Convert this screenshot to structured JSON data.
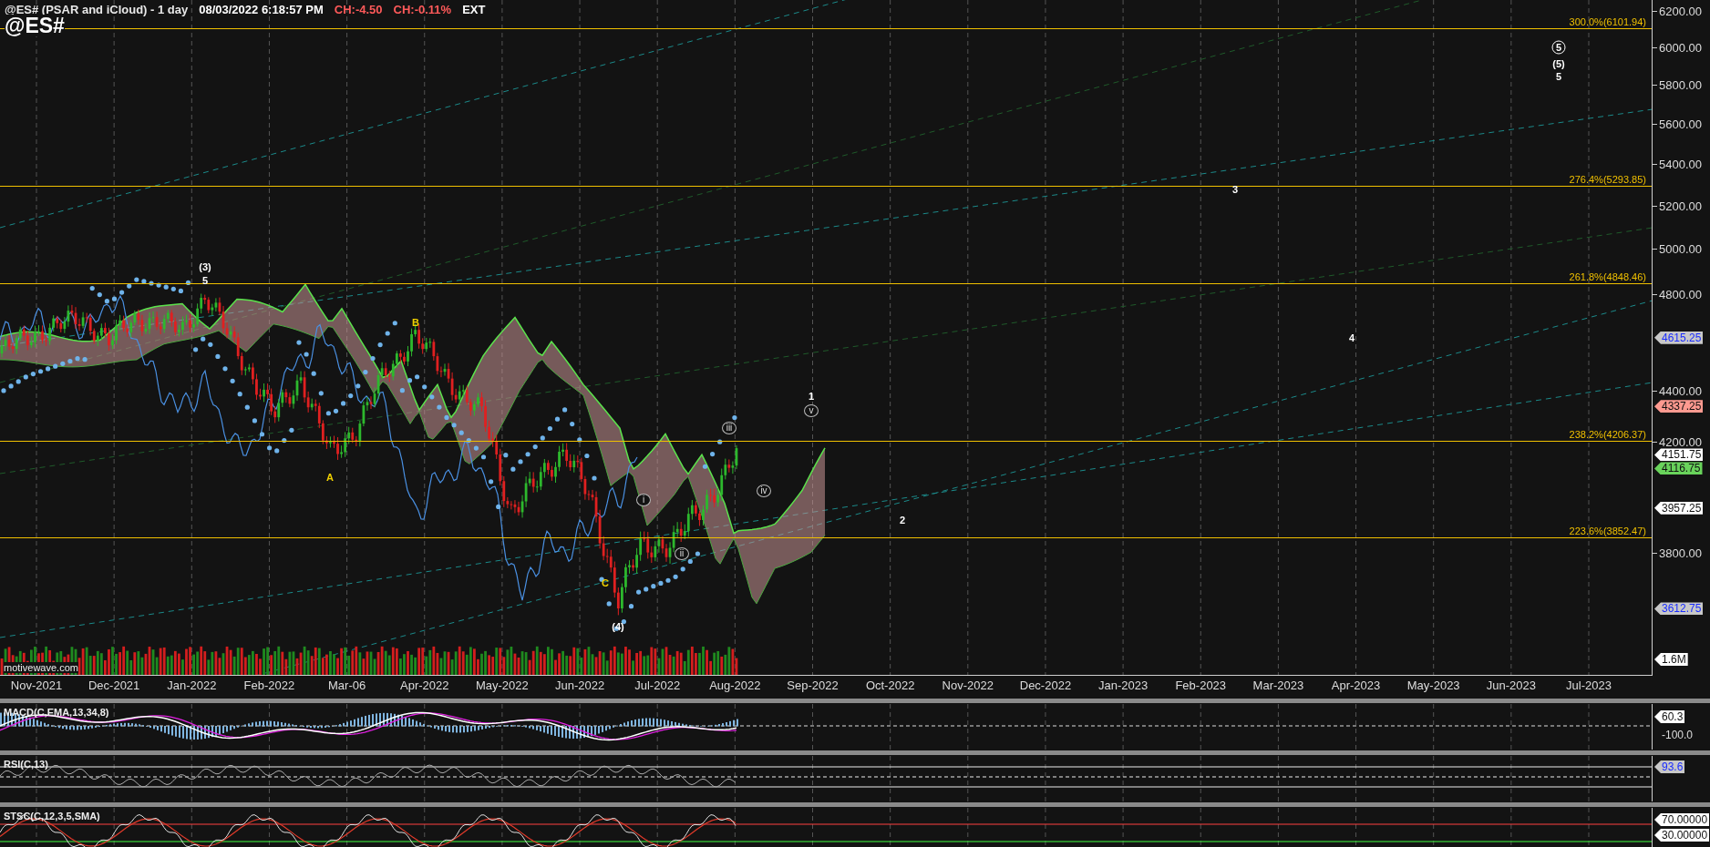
{
  "header": {
    "title": "@ES# (PSAR and iCloud) - 1 day",
    "timestamp": "08/03/2022 6:18:57 PM",
    "changes": [
      "CH:-4.50",
      "CH:-0.11%"
    ],
    "session": "EXT",
    "symbol": "@ES#"
  },
  "source": "motivewave.com",
  "price_axis": {
    "ticks": [
      "6200.00",
      "6000.00",
      "5800.00",
      "5600.00",
      "5400.00",
      "5200.00",
      "5000.00",
      "4800.00",
      "4400.00",
      "4200.00",
      "3800.00"
    ],
    "tags": [
      {
        "text": "4615.25",
        "kind": "blue"
      },
      {
        "text": "4337.25",
        "kind": "red"
      },
      {
        "text": "4151.75",
        "kind": "white"
      },
      {
        "text": "4116.75",
        "kind": "green"
      },
      {
        "text": "3957.25",
        "kind": "white"
      },
      {
        "text": "3612.75",
        "kind": "blue"
      }
    ],
    "volume_tag": "1.6M"
  },
  "fib_levels": [
    "300.0%(6101.94)",
    "276.4%(5293.85)",
    "261.8%(4848.46)",
    "238.2%(4206.37)",
    "223.6%(3852.47)"
  ],
  "wave_labels": [
    {
      "text": "(3)",
      "kind": "plain"
    },
    {
      "text": "5",
      "kind": "plain"
    },
    {
      "text": "B",
      "kind": "letter"
    },
    {
      "text": "A",
      "kind": "letter"
    },
    {
      "text": "C",
      "kind": "letter"
    },
    {
      "text": "(4)",
      "kind": "plain"
    },
    {
      "text": "i",
      "kind": "roman"
    },
    {
      "text": "ii",
      "kind": "roman"
    },
    {
      "text": "iii",
      "kind": "roman"
    },
    {
      "text": "iv",
      "kind": "roman"
    },
    {
      "text": "1",
      "kind": "plain"
    },
    {
      "text": "v",
      "kind": "roman"
    },
    {
      "text": "2",
      "kind": "plain"
    },
    {
      "text": "3",
      "kind": "plain"
    },
    {
      "text": "4",
      "kind": "plain"
    },
    {
      "text": "5",
      "kind": "circled"
    },
    {
      "text": "(5)",
      "kind": "plain"
    },
    {
      "text": "5",
      "kind": "plain"
    }
  ],
  "date_axis": [
    "Nov-2021",
    "Dec-2021",
    "Jan-2022",
    "Feb-2022",
    "Mar-06",
    "Apr-2022",
    "May-2022",
    "Jun-2022",
    "Jul-2022",
    "Aug-2022",
    "Sep-2022",
    "Oct-2022",
    "Nov-2022",
    "Dec-2022",
    "Jan-2023",
    "Feb-2023",
    "Mar-2023",
    "Apr-2023",
    "May-2023",
    "Jun-2023",
    "Jul-2023"
  ],
  "indicators": [
    {
      "kind": "macd",
      "label": "MACD(C,EMA,13,34,8)",
      "tags": [
        {
          "text": "60.3",
          "kind": "white"
        },
        {
          "text": "-100.0",
          "kind": "plain"
        }
      ]
    },
    {
      "kind": "rsi",
      "label": "RSI(C,13)",
      "tags": [
        {
          "text": "93.6",
          "kind": "blue"
        }
      ]
    },
    {
      "kind": "stsc",
      "label": "STSC(C,12,3,5,SMA)",
      "tags": [
        {
          "text": "70.00000",
          "kind": "white"
        },
        {
          "text": "30.00000",
          "kind": "white"
        }
      ]
    }
  ]
}
